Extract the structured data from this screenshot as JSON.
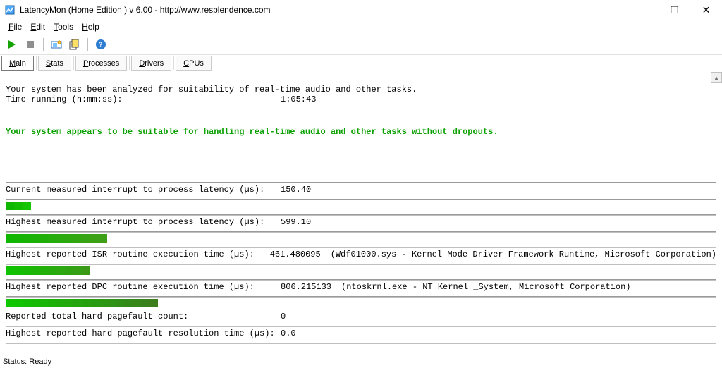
{
  "window": {
    "title": "LatencyMon  (Home Edition )  v 6.00 - http://www.resplendence.com",
    "controls": {
      "minimize": "—",
      "maximize": "☐",
      "close": "✕"
    }
  },
  "menu": {
    "file": "File",
    "edit": "Edit",
    "tools": "Tools",
    "help": "Help"
  },
  "tabs": {
    "main": "Main",
    "stats": "Stats",
    "processes": "Processes",
    "drivers": "Drivers",
    "cpus": "CPUs"
  },
  "report": {
    "headline": "Your system has been analyzed for suitability of real-time audio and other tasks.",
    "time_running_label": "Time running (h:mm:ss):",
    "time_running_value": "1:05:43",
    "verdict": "Your system appears to be suitable for handling real-time audio and other tasks without dropouts.",
    "metrics": [
      {
        "label": "Current measured interrupt to process latency (µs):",
        "value": "150.40",
        "extra": "",
        "bar_segments": 3,
        "gradient_start": "#0fb700",
        "gradient_end": "#16c400"
      },
      {
        "label": "Highest measured interrupt to process latency (µs):",
        "value": "599.10",
        "extra": "",
        "bar_segments": 12,
        "gradient_start": "#0fb700",
        "gradient_end": "#3fa018"
      },
      {
        "label": "Highest reported ISR routine execution time (µs):",
        "value": "461.480095",
        "extra": "(Wdf01000.sys - Kernel Mode Driver Framework Runtime, Microsoft Corporation)",
        "bar_segments": 10,
        "gradient_start": "#0fc300",
        "gradient_end": "#3a9a18"
      },
      {
        "label": "Highest reported DPC routine execution time (µs):",
        "value": "806.215133",
        "extra": "(ntoskrnl.exe - NT Kernel _System, Microsoft Corporation)",
        "bar_segments": 18,
        "gradient_start": "#0fc700",
        "gradient_end": "#3c7d1e"
      }
    ],
    "pagefault_count_label": "Reported total hard pagefault count:",
    "pagefault_count_value": "0",
    "pagefault_time_label": "Highest reported hard pagefault resolution time (µs):",
    "pagefault_time_value": "0.0"
  },
  "status": {
    "text": "Status: Ready"
  }
}
